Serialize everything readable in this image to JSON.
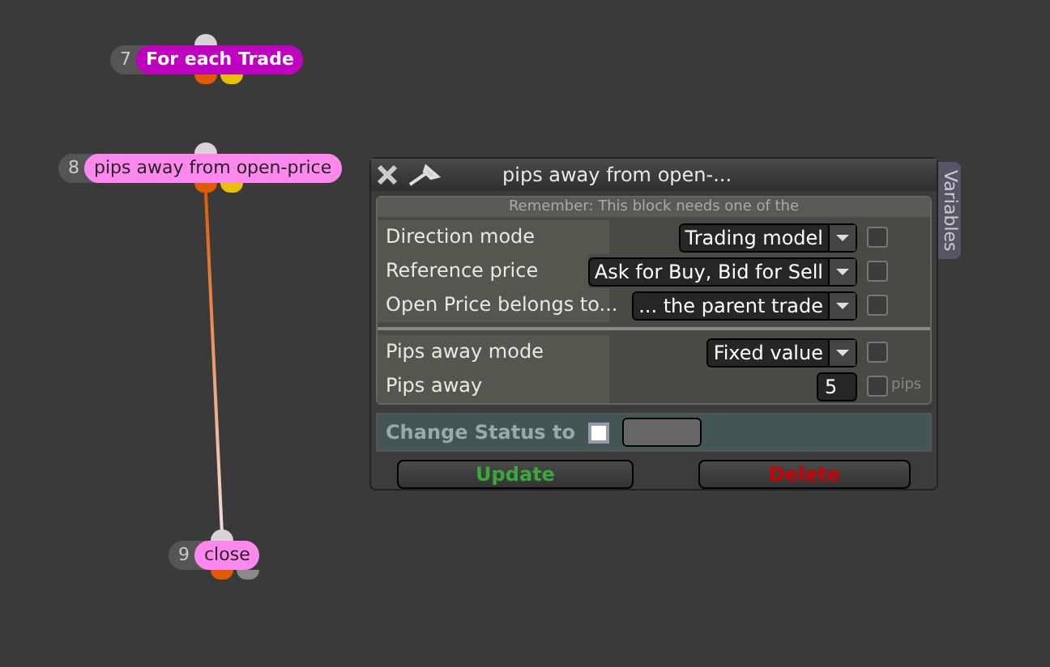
{
  "nodes": [
    {
      "number": "7",
      "label": "For each Trade",
      "color": "#c000c0",
      "bold": true
    },
    {
      "number": "8",
      "label": "pips away from open-price",
      "color": "#ff88ee",
      "bold": false
    },
    {
      "number": "9",
      "label": "close",
      "color": "#ff88ee",
      "bold": false
    }
  ],
  "dialog": {
    "title": "pips away from open-...",
    "side_tab": "Variables",
    "notice": "Remember: This block needs one of the",
    "groups": [
      [
        {
          "kind": "dropdown",
          "label": "Direction mode",
          "value": "Trading model",
          "checked": false
        },
        {
          "kind": "dropdown",
          "label": "Reference price",
          "value": "Ask for Buy, Bid for Sell",
          "checked": false
        },
        {
          "kind": "dropdown",
          "label": "Open Price belongs to...",
          "value": "... the parent trade",
          "checked": false
        }
      ],
      [
        {
          "kind": "dropdown",
          "label": "Pips away mode",
          "value": "Fixed value",
          "checked": false
        },
        {
          "kind": "number",
          "label": "Pips away",
          "value": "5",
          "checked": false,
          "unit": "pips"
        }
      ]
    ],
    "status": {
      "label": "Change Status to",
      "checked": false
    },
    "buttons": [
      {
        "label": "Update",
        "kind": "confirm"
      },
      {
        "label": "Delete",
        "kind": "danger"
      }
    ]
  }
}
